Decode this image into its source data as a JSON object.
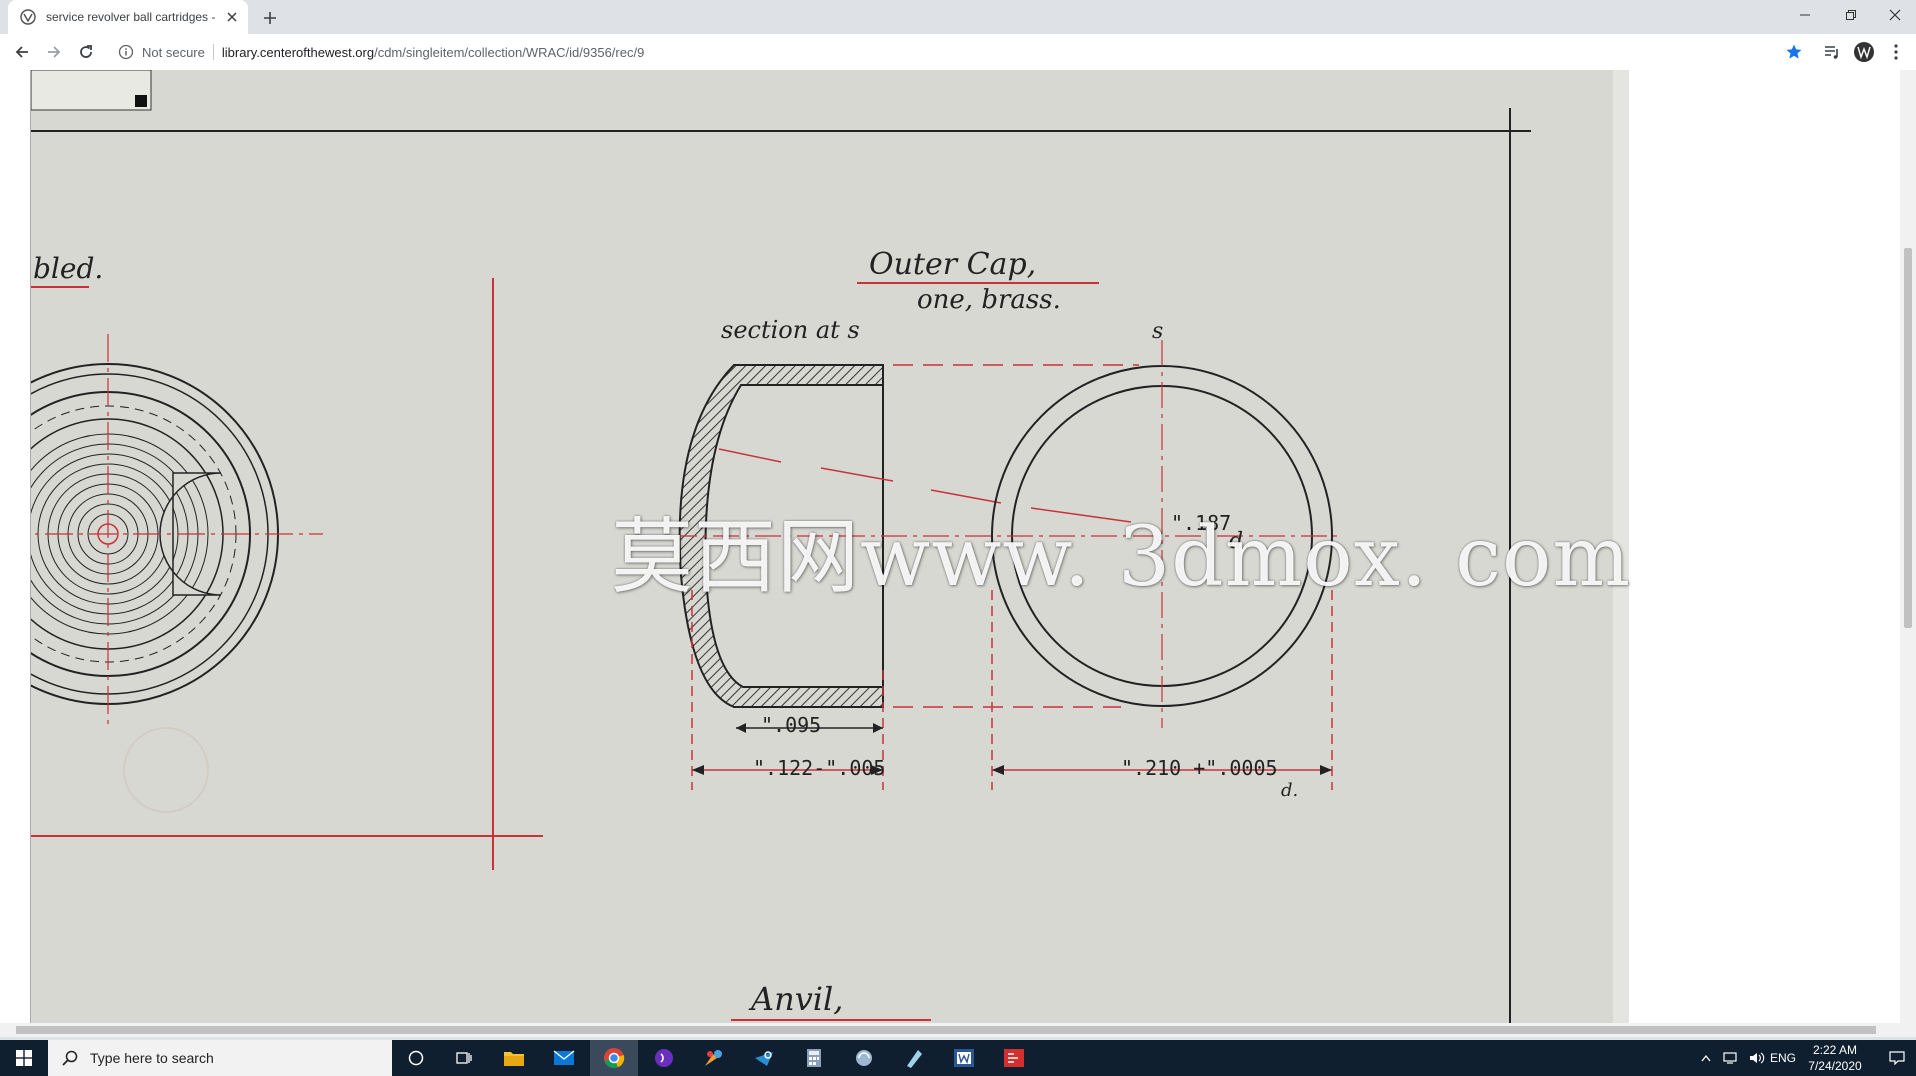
{
  "browser": {
    "tab_title": "service revolver ball cartridges - ",
    "new_tab_label": "+",
    "security_label": "Not secure",
    "url_domain": "library.centerofthewest.org",
    "url_path": "/cdm/singleitem/collection/WRAC/id/9356/rec/9"
  },
  "drawing": {
    "left_label": "bled.",
    "title_outer_cap": "Outer Cap,",
    "subtitle": "one, brass.",
    "section_label": "section at s",
    "marker_s": "s",
    "dim_187": "\".187",
    "dim_187_suffix": "d.",
    "dim_095": "\".095",
    "dim_122": "\".122-\".005",
    "dim_210": "\".210 +\".0005",
    "dim_210_suffix": "d.",
    "anvil_label": "Anvil,"
  },
  "watermark": "莫西网www. 3dmox. com",
  "taskbar": {
    "search_placeholder": "Type here to search",
    "lang": "ENG",
    "time": "2:22 AM",
    "date": "7/24/2020"
  },
  "colors": {
    "paper": "#d8d8d3",
    "ink": "#222222",
    "red_ink": "#c8323a",
    "taskbar": "#101f30"
  }
}
